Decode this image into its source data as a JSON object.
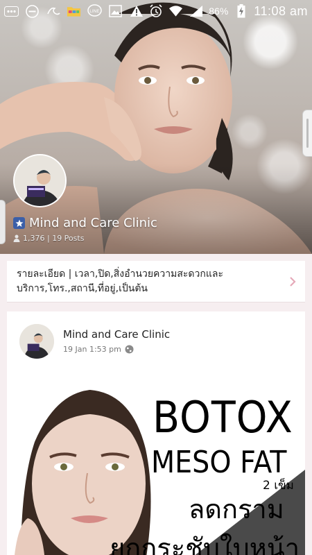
{
  "status_bar": {
    "battery": "86%",
    "time": "11:08 am",
    "icons": [
      "bbm-icon",
      "do-not-disturb-icon",
      "swirl-app-icon",
      "folder-icon",
      "line-icon",
      "gallery-icon",
      "warning-icon",
      "alarm-icon",
      "wifi-icon",
      "signal-icon",
      "battery-charging-icon"
    ]
  },
  "page": {
    "name": "Mind and Care Clinic",
    "stats": "1,376 | 19 Posts"
  },
  "info": {
    "text": "รายละเอียด | เวลา,ปิด,สิ่งอำนวยความสะดวกและบริการ,โทร.,สถานี,ที่อยู่,เป็นต้น"
  },
  "post": {
    "author": "Mind and Care Clinic",
    "time": "19 Jan 1:53 pm",
    "image": {
      "line1": "BOTOX",
      "line2": "MESO FAT",
      "line3": "2 เข็ม",
      "line4": "ลดกราม",
      "line5": "ยกกระชับใบหน้า"
    }
  },
  "colors": {
    "page_bg": "#f6eef0",
    "verified": "#3b5fa8",
    "chevron": "#e5a9b8"
  }
}
